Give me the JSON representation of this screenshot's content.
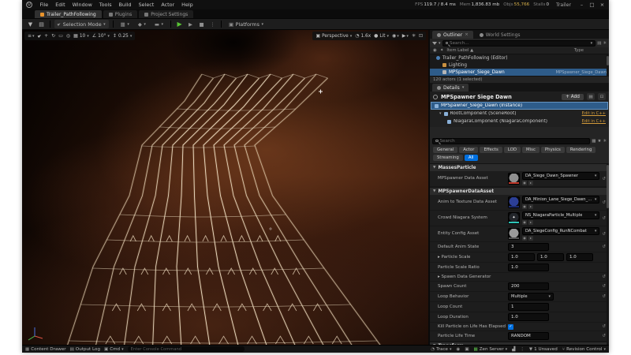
{
  "titlebar": {
    "title": "Trailer",
    "minimize": "–",
    "maximize": "□",
    "close": "×"
  },
  "menubar": {
    "items": [
      "File",
      "Edit",
      "Window",
      "Tools",
      "Build",
      "Select",
      "Actor",
      "Help"
    ]
  },
  "stats": {
    "fps_label": "FPS",
    "fps_value": "119.7 / 8.4 ms",
    "mem_label": "Mem",
    "mem_value": "1,836.83 mb",
    "objs_label": "Objs",
    "objs_value": "55,766",
    "stalls_label": "Stalls",
    "stalls_value": "0"
  },
  "tabs": [
    {
      "label": "Trailer_PathFollowing",
      "active": true
    },
    {
      "label": "Plugins",
      "active": false
    },
    {
      "label": "Project Settings",
      "active": false
    }
  ],
  "toolbar": {
    "selection_mode": "Selection Mode",
    "platforms": "Platforms"
  },
  "viewport_bar": {
    "perspective": "Perspective",
    "screen_scale": "1.6x",
    "lit": "Lit",
    "snap_grid": "10",
    "snap_rotate": "10°",
    "snap_scale": "0.25"
  },
  "outliner": {
    "tab": "Outliner",
    "tab2": "World Settings",
    "search_placeholder": "Search...",
    "col_label": "Item Label ▲",
    "col_type": "Type",
    "rows": [
      {
        "icon": "world",
        "label": "Trailer_PathFollowing (Editor)",
        "type": "",
        "selected": false,
        "indent": 8
      },
      {
        "icon": "folder",
        "label": "Lighting",
        "type": "",
        "selected": false,
        "indent": 16
      },
      {
        "icon": "actor",
        "label": "MPSpawner_Siege_Dawn",
        "type": "MPSpawner_Siege_Dawn",
        "selected": true,
        "indent": 16
      }
    ],
    "footer": "120 actors (1 selected)"
  },
  "details": {
    "tab": "Details",
    "actor_name": "MPSpawner Siege Dawn",
    "add_label": "+ Add",
    "components": [
      {
        "name": "MPSpawner_Siege_Dawn (Instance)",
        "link": ""
      },
      {
        "name": "RootComponent (SceneRoot)",
        "link": "Edit in C++"
      },
      {
        "name": "NiagaraComponent (NiagaraComponent)",
        "link": "Edit in C++"
      }
    ],
    "search_placeholder": "Search",
    "filters": [
      "General",
      "Actor",
      "Effects",
      "LOD",
      "Misc",
      "Physics",
      "Rendering",
      "Streaming",
      "All"
    ],
    "active_filter": "All",
    "rows": [
      {
        "kind": "section",
        "label": "MassesParticle"
      },
      {
        "kind": "asset",
        "label": "MPSpawner Data Asset",
        "value": "DA_Siege_Dawn_Spawner",
        "thumb": "#8f8f8f",
        "stripe": "#c0392b",
        "sparkle": false
      },
      {
        "kind": "section",
        "label": "MPSpawnerDataAsset"
      },
      {
        "kind": "asset",
        "label": "Anim to Texture Data Asset",
        "value": "DA_Minion_Lane_Siege_Dawn_BOT",
        "thumb": "#2c3f96",
        "stripe": "#1b2a6e",
        "sparkle": false
      },
      {
        "kind": "asset",
        "label": "Crowd Niagara System",
        "value": "NS_NiagaraParticle_Multiple",
        "thumb": "#23262b",
        "stripe": "#2ec4b6",
        "sparkle": true
      },
      {
        "kind": "asset",
        "label": "Entity Config Asset",
        "value": "DA_SiegeConfig_RunNCombat",
        "thumb": "#9a9a9a",
        "stripe": "#555555",
        "sparkle": false
      },
      {
        "kind": "number",
        "label": "Default Anim State",
        "value": "3",
        "reset": true
      },
      {
        "kind": "vec3",
        "label": "Particle Scale",
        "values": [
          "1.0",
          "1.0",
          "1.0"
        ]
      },
      {
        "kind": "number",
        "label": "Particle Scale Ratio",
        "value": "1.0"
      },
      {
        "kind": "expand",
        "label": "Spawn Data Generator",
        "reset": true
      },
      {
        "kind": "number",
        "label": "Spawn Count",
        "value": "200",
        "reset": true
      },
      {
        "kind": "dropdown",
        "label": "Loop Behavior",
        "value": "Multiple",
        "reset": true
      },
      {
        "kind": "number",
        "label": "Loop Count",
        "value": "1"
      },
      {
        "kind": "number",
        "label": "Loop Duration",
        "value": "1.0"
      },
      {
        "kind": "check",
        "label": "Kill Particle on Life Has Elapsed",
        "checked": true,
        "reset": true
      },
      {
        "kind": "number",
        "label": "Particle Life Time",
        "value": "RANDOM",
        "reset": true
      },
      {
        "kind": "section",
        "label": "Transform"
      }
    ]
  },
  "statusbar": {
    "content_drawer": "Content Drawer",
    "output_log": "Output Log",
    "cmd": "Cmd",
    "console_placeholder": "Enter Console Command",
    "trace": "Trace",
    "zen": "Zen Server",
    "unsaved": "1 Unsaved",
    "revision": "Revision Control"
  },
  "colors": {
    "accent": "#0070e0",
    "selection": "#2e5c8a",
    "cpp_link": "#d29a3a",
    "play_green": "#58c434",
    "zen_green": "#58b848",
    "spline": "#f7ead2",
    "spline_glow": "#ffd89a",
    "terrain_dark": "#190b06",
    "terrain_mid": "#44200f"
  }
}
